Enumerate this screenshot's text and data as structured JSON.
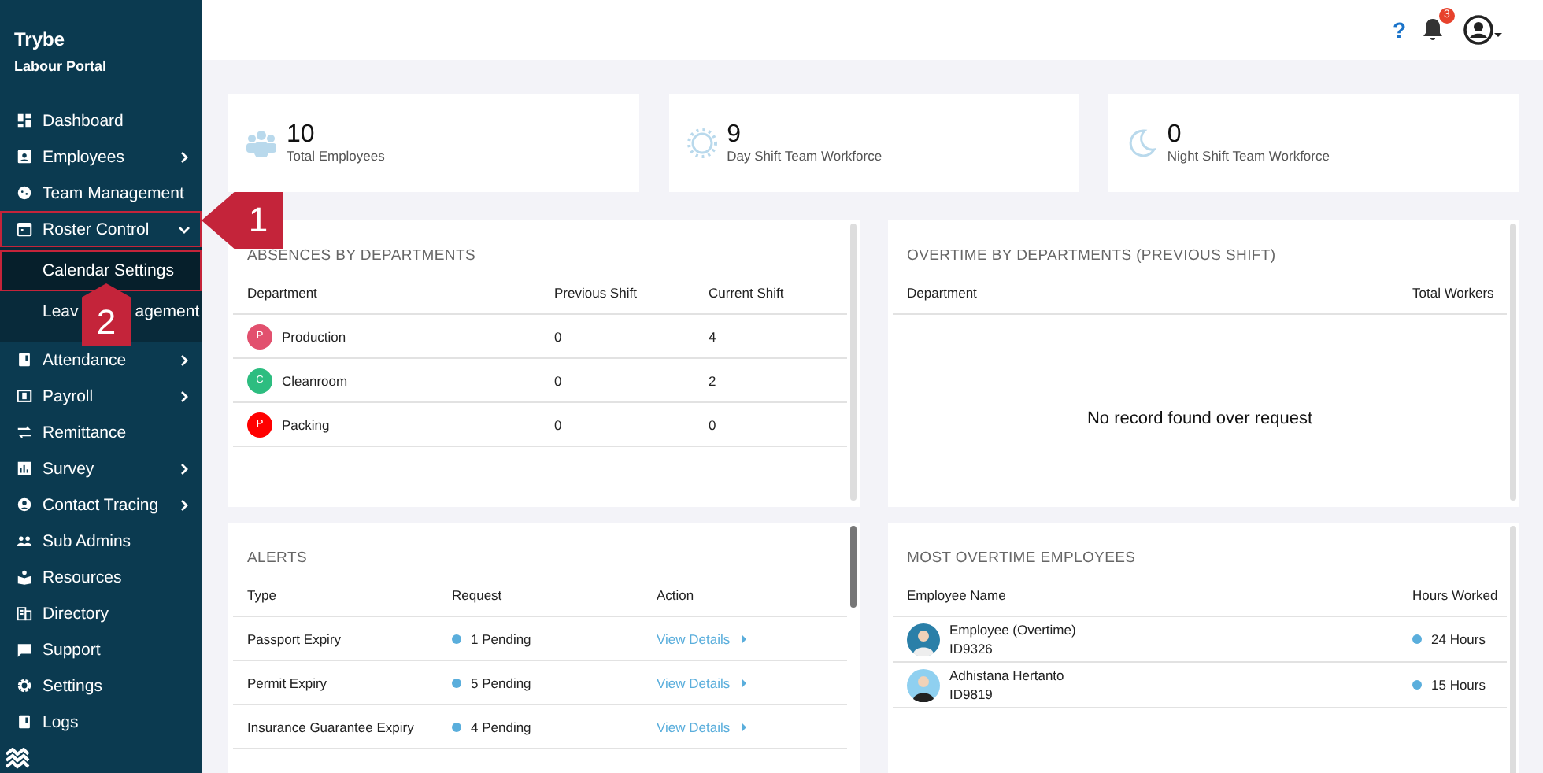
{
  "sidebar": {
    "brand": "Trybe",
    "subtitle": "Labour Portal",
    "items": [
      {
        "label": "Dashboard",
        "has_submenu": false,
        "outlined": false
      },
      {
        "label": "Employees",
        "has_submenu": true,
        "expanded": false,
        "outlined": false
      },
      {
        "label": "Team Management",
        "has_submenu": false,
        "outlined": false
      },
      {
        "label": "Roster Control",
        "has_submenu": true,
        "expanded": true,
        "outlined": true,
        "children": [
          {
            "label_parts": [
              "Calendar Settings"
            ],
            "selected": true,
            "outlined": true
          },
          {
            "label_parts": [
              "Leav",
              "agement"
            ],
            "selected": false,
            "outlined": false
          }
        ]
      },
      {
        "label": "Attendance",
        "has_submenu": true,
        "expanded": false,
        "outlined": false
      },
      {
        "label": "Payroll",
        "has_submenu": true,
        "expanded": false,
        "outlined": false
      },
      {
        "label": "Remittance",
        "has_submenu": false,
        "outlined": false
      },
      {
        "label": "Survey",
        "has_submenu": true,
        "expanded": false,
        "outlined": false
      },
      {
        "label": "Contact Tracing",
        "has_submenu": true,
        "expanded": false,
        "outlined": false
      },
      {
        "label": "Sub Admins",
        "has_submenu": false,
        "outlined": false
      },
      {
        "label": "Resources",
        "has_submenu": false,
        "outlined": false
      },
      {
        "label": "Directory",
        "has_submenu": false,
        "outlined": false
      },
      {
        "label": "Support",
        "has_submenu": false,
        "outlined": false
      },
      {
        "label": "Settings",
        "has_submenu": false,
        "outlined": false
      },
      {
        "label": "Logs",
        "has_submenu": false,
        "outlined": false
      }
    ]
  },
  "topbar": {
    "help": "?",
    "notifications": "3"
  },
  "stats": [
    {
      "value": "10",
      "label": "Total Employees"
    },
    {
      "value": "9",
      "label": "Day Shift Team Workforce"
    },
    {
      "value": "0",
      "label": "Night Shift Team Workforce"
    }
  ],
  "absences": {
    "title": "ABSENCES BY DEPARTMENTS",
    "columns": [
      "Department",
      "Previous Shift",
      "Current Shift"
    ],
    "rows": [
      {
        "badge": "P",
        "color": "#e2506e",
        "department": "Production",
        "previous": "0",
        "current": "4"
      },
      {
        "badge": "C",
        "color": "#2dbd80",
        "department": "Cleanroom",
        "previous": "0",
        "current": "2"
      },
      {
        "badge": "P",
        "color": "#ff0000",
        "department": "Packing",
        "previous": "0",
        "current": "0"
      }
    ]
  },
  "overtime_by_departments": {
    "title": "OVERTIME BY DEPARTMENTS (PREVIOUS SHIFT)",
    "columns": [
      "Department",
      "Total Workers"
    ],
    "empty_message": "No record found over request"
  },
  "alerts": {
    "title": "ALERTS",
    "columns": [
      "Type",
      "Request",
      "Action"
    ],
    "rows": [
      {
        "type": "Passport Expiry",
        "request": "1 Pending",
        "action": "View Details"
      },
      {
        "type": "Permit Expiry",
        "request": "5 Pending",
        "action": "View Details"
      },
      {
        "type": "Insurance Guarantee Expiry",
        "request": "4 Pending",
        "action": "View Details"
      }
    ]
  },
  "most_overtime": {
    "title": "MOST OVERTIME EMPLOYEES",
    "columns": [
      "Employee Name",
      "Hours Worked"
    ],
    "rows": [
      {
        "name": "Employee (Overtime)",
        "id": "ID9326",
        "hours": "24 Hours"
      },
      {
        "name": "Adhistana Hertanto",
        "id": "ID9819",
        "hours": "15 Hours"
      }
    ]
  },
  "annotations": [
    {
      "label": "1"
    },
    {
      "label": "2"
    }
  ]
}
